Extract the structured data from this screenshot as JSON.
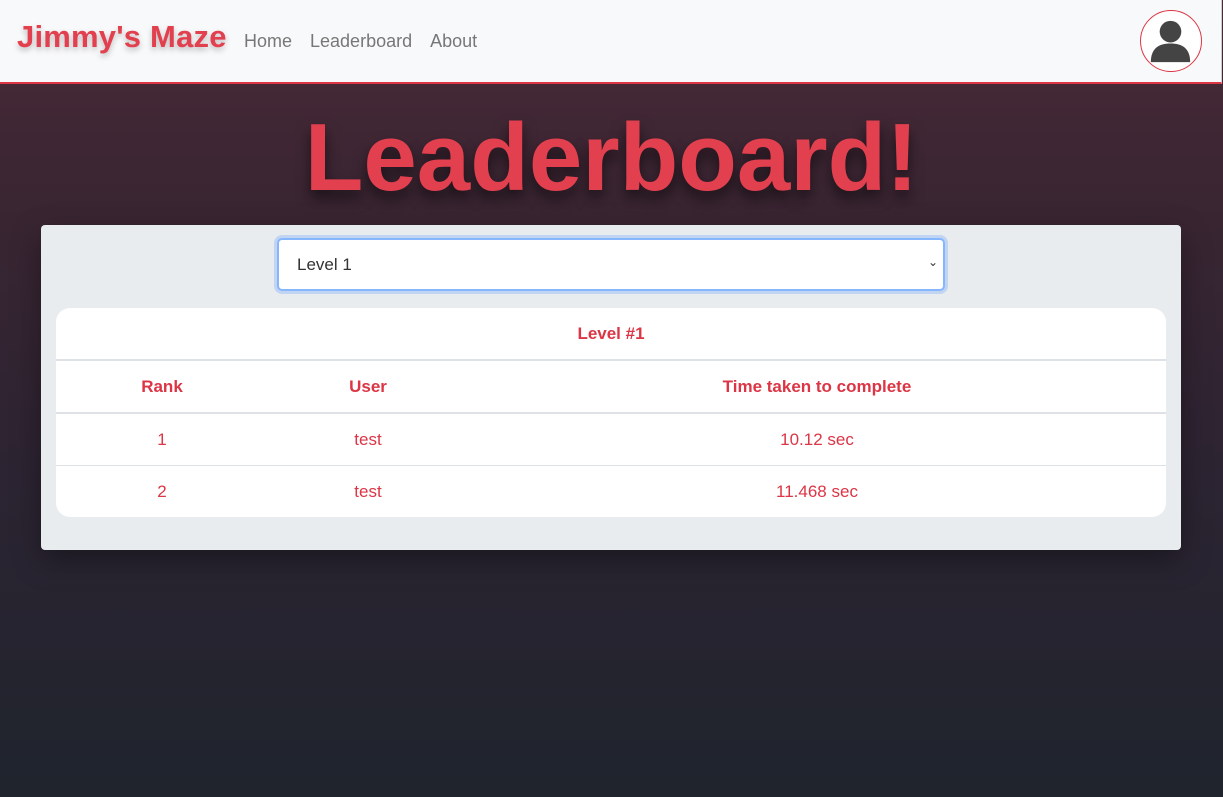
{
  "navbar": {
    "brand": "Jimmy's Maze",
    "links": [
      "Home",
      "Leaderboard",
      "About"
    ]
  },
  "page": {
    "title": "Leaderboard!"
  },
  "level_select": {
    "selected": "Level 1"
  },
  "table": {
    "caption": "Level #1",
    "headers": [
      "Rank",
      "User",
      "Time taken to complete"
    ],
    "rows": [
      [
        "1",
        "test",
        "10.12 sec"
      ],
      [
        "2",
        "test",
        "11.468 sec"
      ]
    ]
  },
  "colors": {
    "accent": "#dc3545",
    "navbar_bg": "#f8f9fa",
    "panel_bg": "#e9ecef"
  },
  "icons": {
    "avatar": "user-avatar-icon",
    "select": "chevron-down-icon"
  }
}
